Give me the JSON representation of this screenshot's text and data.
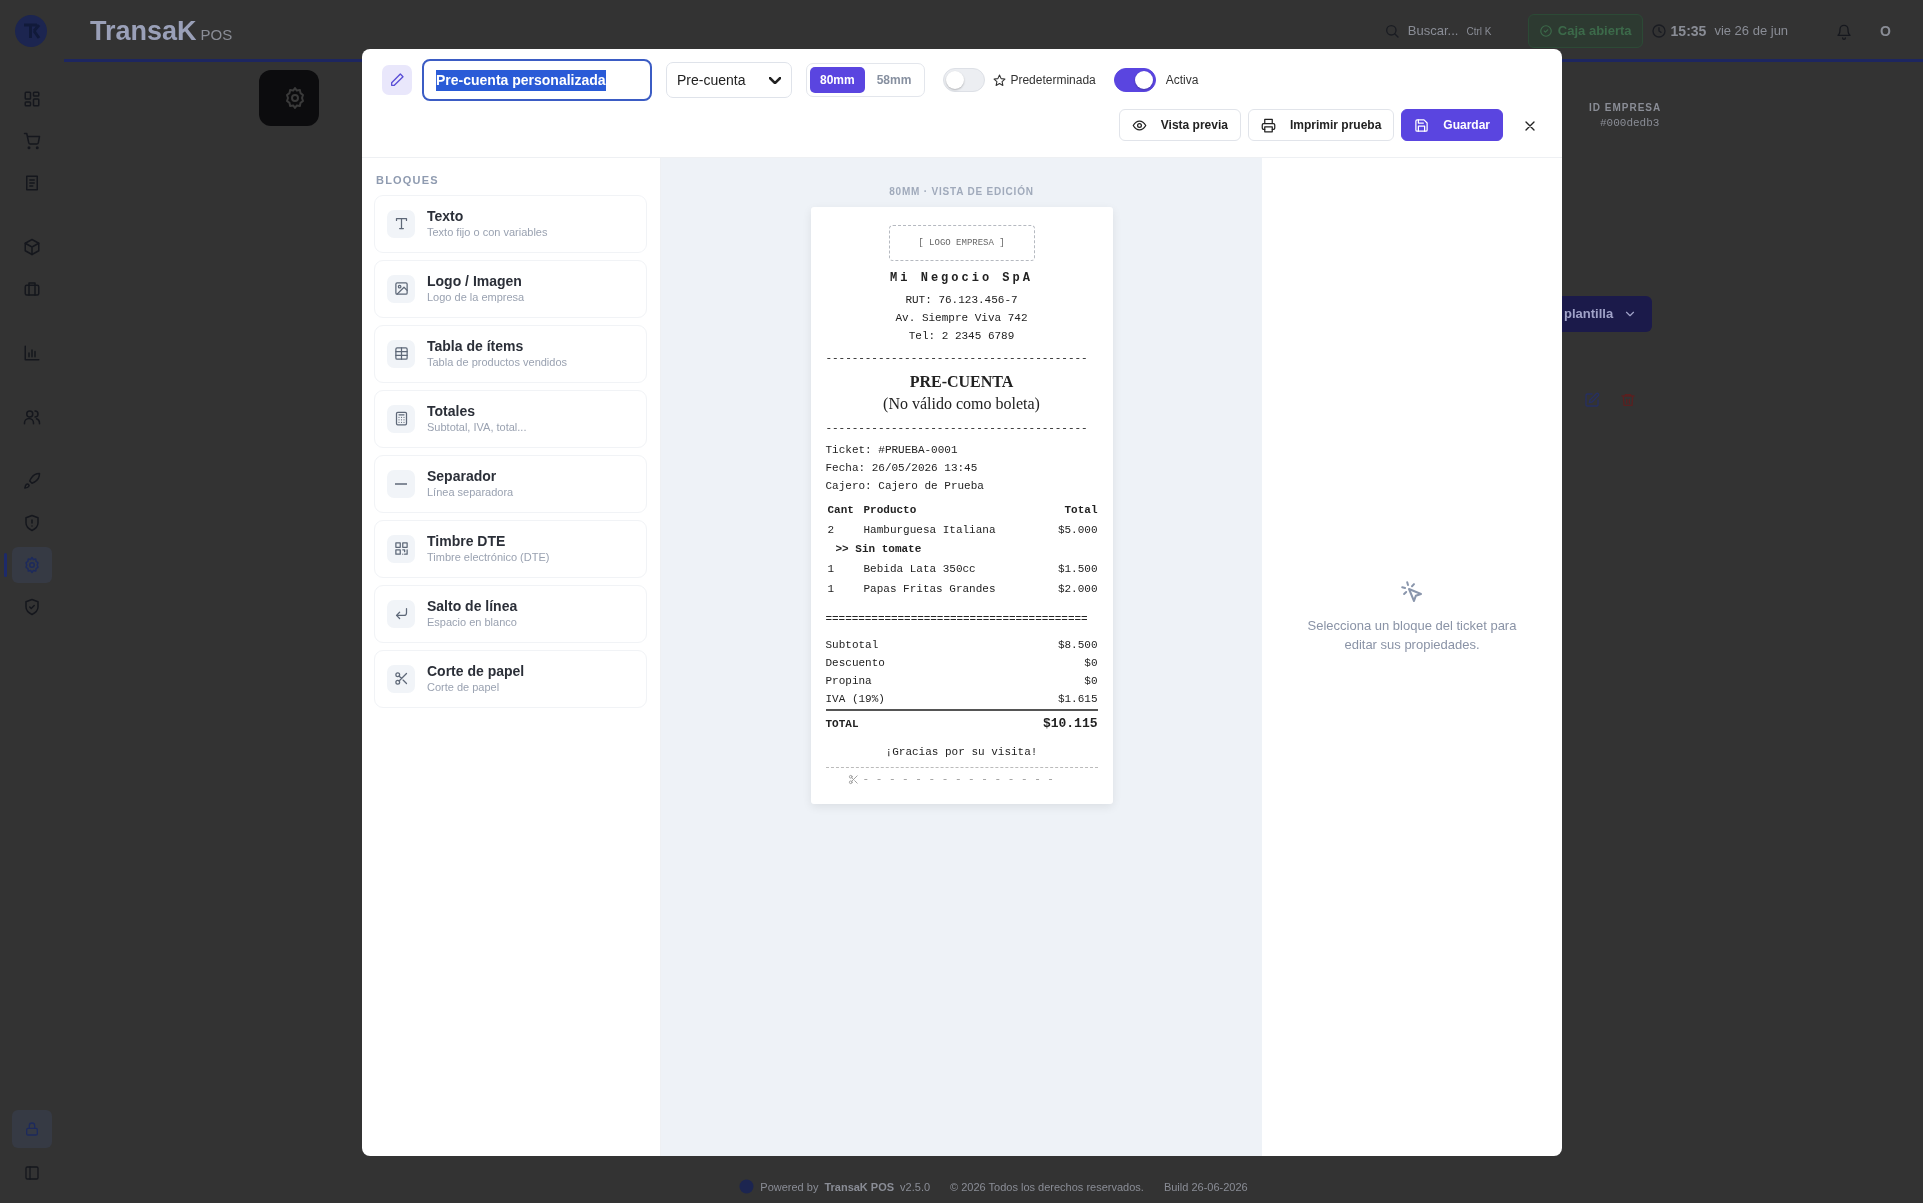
{
  "app": {
    "brand": "TransaK",
    "brand_suffix": "POS",
    "search_placeholder": "Buscar...",
    "search_shortcut": "Ctrl K",
    "cash_status": "Caja abierta",
    "time": "15:35",
    "date": "vie 26 de jun",
    "user_initial": "O"
  },
  "sidebar": {
    "sections": [
      {
        "items": [
          {
            "selected": false
          },
          {
            "selected": false
          },
          {
            "selected": false
          }
        ]
      },
      {
        "items": [
          {
            "selected": false
          },
          {
            "selected": false
          }
        ]
      },
      {
        "items": [
          {
            "selected": false
          }
        ]
      },
      {
        "items": [
          {
            "selected": false
          }
        ]
      },
      {
        "items": [
          {
            "selected": false
          },
          {
            "selected": false
          },
          {
            "selected": true
          },
          {
            "selected": false
          }
        ]
      }
    ],
    "bottom_items": [
      {
        "selected": true
      },
      {
        "selected": false
      }
    ]
  },
  "company": {
    "id_label": "ID EMPRESA",
    "id_value": "#000dedb3"
  },
  "background_button": "plantilla",
  "footer": {
    "powered_by": "Powered by",
    "brand": "TransaK POS",
    "version": "v2.5.0",
    "copyright": "© 2026 Todos los derechos reservados.",
    "build": "Build 26-06-2026"
  },
  "editor": {
    "name_value": "Pre-cuenta personalizada",
    "name_text_selected": true,
    "type_select": "Pre-cuenta",
    "widths": [
      {
        "label": "80mm",
        "selected": true
      },
      {
        "label": "58mm",
        "selected": false
      }
    ],
    "default_toggle": {
      "label": "Predeterminada",
      "on": false
    },
    "active_toggle": {
      "label": "Activa",
      "on": true
    },
    "buttons": [
      {
        "label": "Vista previa",
        "kind": "preview"
      },
      {
        "label": "Imprimir prueba",
        "kind": "print"
      },
      {
        "label": "Guardar",
        "kind": "save"
      }
    ]
  },
  "blocks": {
    "title": "BLOQUES",
    "items": [
      {
        "title": "Texto",
        "subtitle": "Texto fijo o con variables"
      },
      {
        "title": "Logo / Imagen",
        "subtitle": "Logo de la empresa"
      },
      {
        "title": "Tabla de ítems",
        "subtitle": "Tabla de productos vendidos"
      },
      {
        "title": "Totales",
        "subtitle": "Subtotal, IVA, total..."
      },
      {
        "title": "Separador",
        "subtitle": "Línea separadora"
      },
      {
        "title": "Timbre DTE",
        "subtitle": "Timbre electrónico (DTE)"
      },
      {
        "title": "Salto de línea",
        "subtitle": "Espacio en blanco"
      },
      {
        "title": "Corte de papel",
        "subtitle": "Corte de papel"
      }
    ]
  },
  "preview": {
    "caption": "80MM · VISTA DE EDICIÓN",
    "ticket": {
      "logo_placeholder": "[ LOGO EMPRESA ]",
      "business_name": "Mi Negocio SpA",
      "header_lines": [
        "RUT: 76.123.456-7",
        "Av. Siempre Viva 742",
        "Tel: 2 2345 6789"
      ],
      "separator_1": "----------------------------------------",
      "title_lines": [
        "PRE-CUENTA",
        "(No válido como boleta)"
      ],
      "separator_2": "----------------------------------------",
      "info_lines": [
        "Ticket: #PRUEBA-0001",
        "Fecha: 26/05/2026 13:45",
        "Cajero: Cajero de Prueba"
      ],
      "columns": [
        "Cant",
        "Producto",
        "Total"
      ],
      "rows": [
        {
          "qty": "2",
          "product": "Hamburguesa Italiana",
          "total": "$5.000",
          "note": ">> Sin tomate"
        },
        {
          "qty": "1",
          "product": "Bebida Lata 350cc",
          "total": "$1.500"
        },
        {
          "qty": "1",
          "product": "Papas Fritas Grandes",
          "total": "$2.000"
        }
      ],
      "separator_3": "========================================",
      "totals": [
        {
          "label": "Subtotal",
          "value": "$8.500"
        },
        {
          "label": "Descuento",
          "value": "$0"
        },
        {
          "label": "Propina",
          "value": "$0"
        },
        {
          "label": "IVA (19%)",
          "value": "$1.615"
        }
      ],
      "grand_total": {
        "label": "TOTAL",
        "value": "$10.115"
      },
      "thanks": "¡Gracias por su visita!",
      "cut_line": "- - - - - - - - - - - - - - -"
    }
  },
  "properties": {
    "empty_message": "Selecciona un bloque del ticket para editar sus propiedades."
  }
}
